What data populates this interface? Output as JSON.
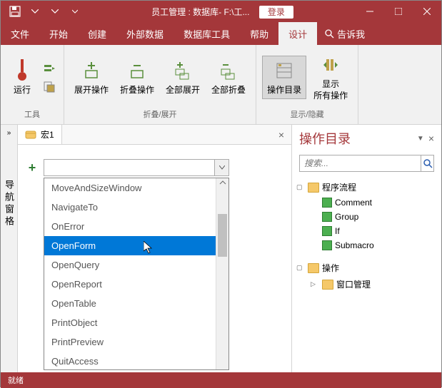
{
  "titlebar": {
    "title": "员工管理 : 数据库- F:\\工...",
    "login": "登录"
  },
  "menu": {
    "file": "文件",
    "home": "开始",
    "create": "创建",
    "external": "外部数据",
    "dbtools": "数据库工具",
    "help": "帮助",
    "design": "设计",
    "tellme": "告诉我"
  },
  "ribbon": {
    "run": "运行",
    "tools_label": "工具",
    "expand": "展开操作",
    "collapse": "折叠操作",
    "expand_all": "全部展开",
    "collapse_all": "全部折叠",
    "fold_label": "折叠/展开",
    "catalog": "操作目录",
    "show_all": "显示\n所有操作",
    "show_label": "显示/隐藏"
  },
  "nav": {
    "label": "导航窗格"
  },
  "doc": {
    "tab": "宏1",
    "dropdown_items": [
      "MoveAndSizeWindow",
      "NavigateTo",
      "OnError",
      "OpenForm",
      "OpenQuery",
      "OpenReport",
      "OpenTable",
      "PrintObject",
      "PrintPreview",
      "QuitAccess"
    ],
    "selected_index": 3
  },
  "catalog": {
    "title": "操作目录",
    "search_placeholder": "搜索...",
    "flow": {
      "label": "程序流程",
      "items": [
        "Comment",
        "Group",
        "If",
        "Submacro"
      ]
    },
    "ops": {
      "label": "操作",
      "child": "窗口管理"
    }
  },
  "status": {
    "text": "就绪"
  }
}
